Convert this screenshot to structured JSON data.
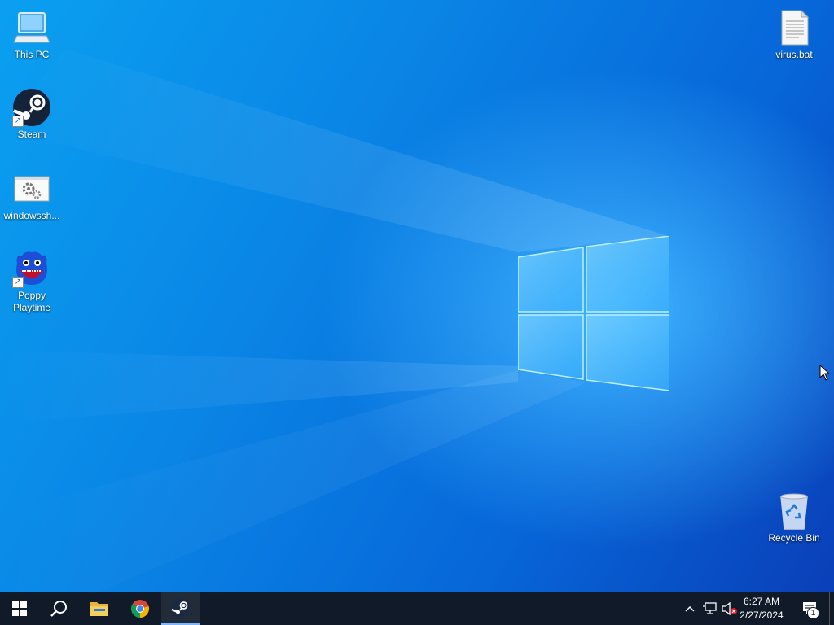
{
  "desktop_icons": {
    "this_pc": "This PC",
    "steam": "Steam",
    "windows_shortcut": "windowssh...",
    "poppy": "Poppy Playtime",
    "virus": "virus.bat",
    "recycle_bin": "Recycle Bin"
  },
  "taskbar": {
    "time": "6:27 AM",
    "date": "2/27/2024",
    "notification_count": "1",
    "pinned": [
      "start-icon",
      "search-icon",
      "file-explorer-icon",
      "chrome-icon",
      "steam-icon"
    ],
    "active_app": "steam"
  },
  "colors": {
    "wallpaper_accent": "#0a86e6",
    "taskbar_bg": "#101a28",
    "active_indicator": "#7cb6ff"
  }
}
